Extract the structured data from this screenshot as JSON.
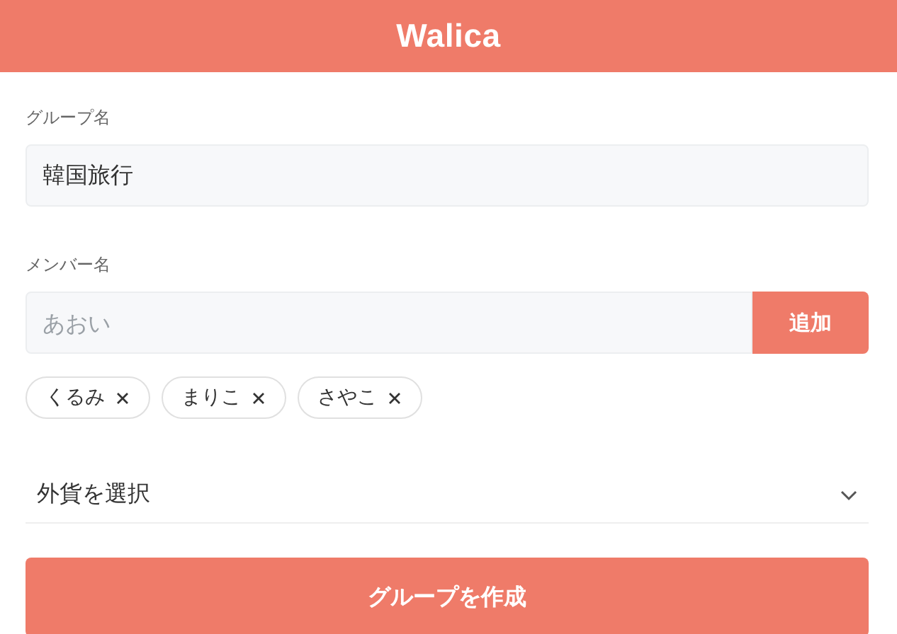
{
  "header": {
    "title": "Walica"
  },
  "group_name": {
    "label": "グループ名",
    "value": "韓国旅行"
  },
  "member_name": {
    "label": "メンバー名",
    "placeholder": "あおい",
    "add_button": "追加"
  },
  "members": [
    {
      "name": "くるみ"
    },
    {
      "name": "まりこ"
    },
    {
      "name": "さやこ"
    }
  ],
  "currency_select": {
    "label": "外貨を選択"
  },
  "create_button": "グループを作成"
}
